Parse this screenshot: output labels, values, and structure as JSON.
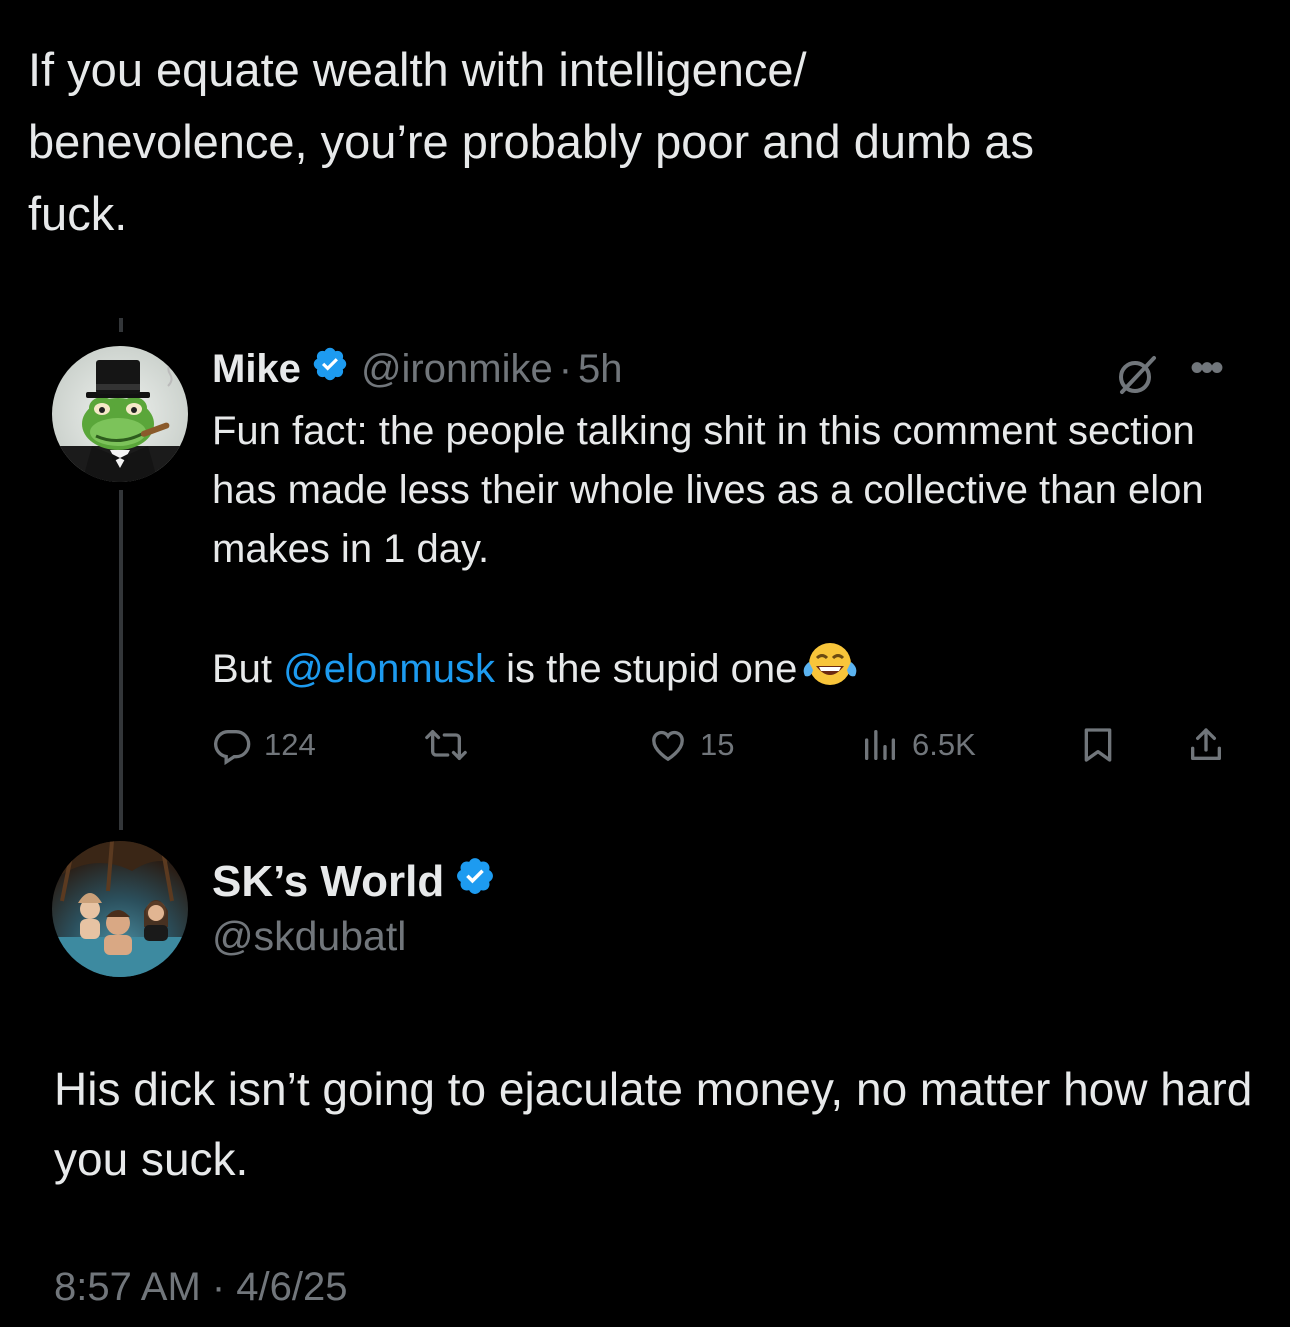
{
  "caption": "If you equate wealth with intelligence/\nbenevolence, you’re probably poor and dumb as\nfuck.",
  "quoted_post": {
    "author_name": "Mike",
    "author_handle": "@ironmike",
    "separator": "·",
    "time_ago": "5h",
    "verified": true,
    "avatar_icon": "frog-top-hat-avatar",
    "body_line1": "Fun fact: the people talking shit in this comment section has made less their whole lives as a collective than elon makes in 1 day.",
    "body_line2_before": "But ",
    "body_mention": "@elonmusk",
    "body_line2_after": " is the stupid one",
    "body_emoji": "face-with-tears-of-joy",
    "replies": "124",
    "likes": "15",
    "views": "6.5K"
  },
  "reply": {
    "author_name": "SK’s World",
    "author_handle": "@skdubatl",
    "verified": true,
    "avatar_icon": "group-photo-avatar",
    "body": "His dick isn’t going to ejaculate money, no matter how hard you suck.",
    "timestamp": "8:57 AM · 4/6/25"
  },
  "colors": {
    "background": "#000000",
    "primary_text": "#e7e9ea",
    "secondary_text": "#71767b",
    "link": "#1d9bf0",
    "verified_badge": "#1d9bf0",
    "thread_line": "#333639"
  }
}
